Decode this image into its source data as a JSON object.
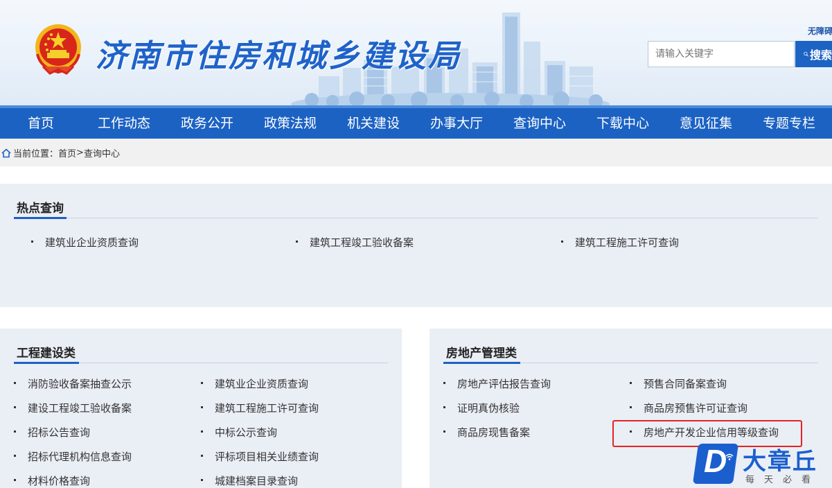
{
  "header": {
    "site_title": "济南市住房和城乡建设局",
    "accessibility_label": "无障碍",
    "search_placeholder": "请输入关键字",
    "search_button": "搜索"
  },
  "nav": {
    "items": [
      "首页",
      "工作动态",
      "政务公开",
      "政策法规",
      "机关建设",
      "办事大厅",
      "查询中心",
      "下载中心",
      "意见征集",
      "专题专栏"
    ]
  },
  "breadcrumb": {
    "label": "当前位置：",
    "home": "首页",
    "separator": ">",
    "current": "查询中心"
  },
  "hot_query": {
    "title": "热点查询",
    "items": [
      "建筑业企业资质查询",
      "建筑工程竣工验收备案",
      "建筑工程施工许可查询"
    ]
  },
  "engineering": {
    "title": "工程建设类",
    "left_items": [
      "消防验收备案抽查公示",
      "建设工程竣工验收备案",
      "招标公告查询",
      "招标代理机构信息查询",
      "材料价格查询"
    ],
    "right_items": [
      "建筑业企业资质查询",
      "建筑工程施工许可查询",
      "中标公示查询",
      "评标项目相关业绩查询",
      "城建档案目录查询"
    ]
  },
  "real_estate": {
    "title": "房地产管理类",
    "left_items": [
      "房地产评估报告查询",
      "证明真伪核验",
      "商品房现售备案"
    ],
    "right_items": [
      "预售合同备案查询",
      "商品房预售许可证查询",
      "房地产开发企业信用等级查询"
    ]
  },
  "watermark": {
    "letter": "D",
    "brand": "大章丘",
    "slogan": "每天必看"
  },
  "colors": {
    "primary": "#1c62c3",
    "title_blue": "#1f63c9",
    "panel_bg": "#eaeef5",
    "highlight": "#e02424"
  }
}
